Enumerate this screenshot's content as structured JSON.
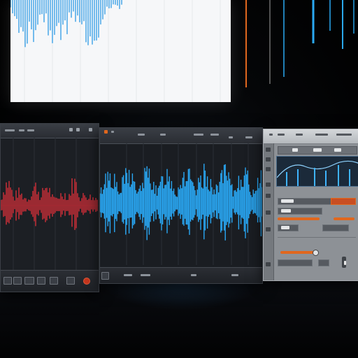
{
  "scene": {
    "background": "#000000",
    "accent_blue": "#2aa9f2",
    "accent_red": "#e0303a",
    "accent_orange": "#e0671e"
  },
  "back_screen": {
    "icons": [
      "waveform-icon"
    ],
    "wave_color": "#3aa0e6"
  },
  "panels": {
    "left": {
      "wave_color": "#e0303a",
      "icons": [
        "record-icon",
        "stop-icon"
      ]
    },
    "center": {
      "wave_color": "#29a8f5",
      "icons": [
        "play-icon",
        "record-icon"
      ]
    },
    "right": {
      "spectrum_color": "#3fb4ff",
      "icons": [
        "equalizer-icon",
        "fader-icon"
      ],
      "slider_colors": [
        "#e0671e",
        "#e0671e",
        "#e0671e"
      ]
    }
  }
}
